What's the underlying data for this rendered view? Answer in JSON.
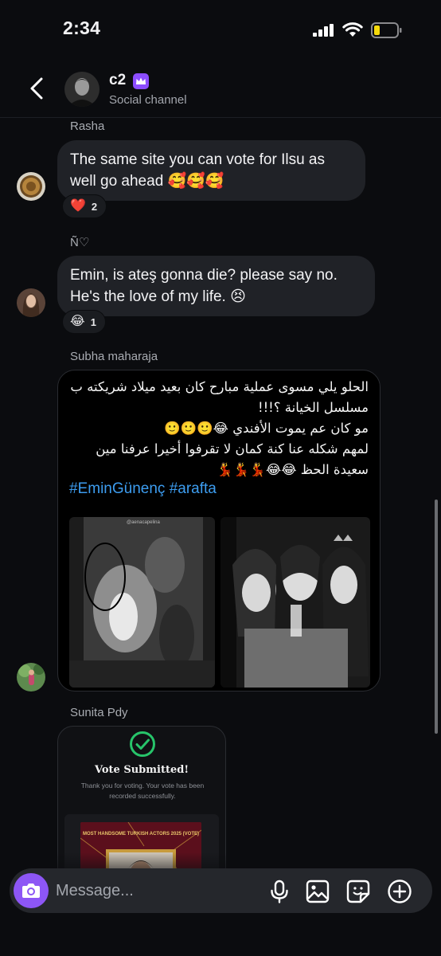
{
  "status_bar": {
    "time": "2:34"
  },
  "header": {
    "channel_name": "c2",
    "subtitle": "Social channel"
  },
  "messages": [
    {
      "sender": "Rasha",
      "text": "The same site you can vote for Ilsu as well go ahead 🥰🥰🥰",
      "reaction": {
        "emoji": "❤️",
        "count": "2"
      }
    },
    {
      "sender": "Ñ♡",
      "text": "Emin, is ateş gonna die? please say no. He's the love of my life. 😣",
      "reaction": {
        "emoji": "😂",
        "count": "1"
      }
    },
    {
      "sender": "Subha maharaja",
      "text_lines": [
        "الحلو يلي مسوى عملية مبارح كان بعيد ميلاد شريكته ب",
        "مسلسل الخيانة ؟!!!",
        "مو كان عم يموت الأفندي 😂🙂🙂🙂",
        "لمهم شكله عنا كنة كمان لا تقرفوا أخيرا عرفنا مين",
        "سعيدة الحظ 😂😂💃💃💃"
      ],
      "hashtags": [
        "#EminGünenç",
        "#arafta"
      ],
      "photo_caption": "@aenacapelina"
    },
    {
      "sender": "Sunita Pdy",
      "card": {
        "title": "Vote Submitted!",
        "text": "Thank you for voting. Your vote has been recorded successfully.",
        "poster_text": "MOST HANDSOME TURKISH ACTORS 2025 (VOTE)"
      }
    }
  ],
  "composer": {
    "placeholder": "Message..."
  },
  "colors": {
    "accent": "#8d56f5",
    "hashtag": "#3d9df0",
    "bubble": "#202227",
    "check": "#27c46a"
  }
}
